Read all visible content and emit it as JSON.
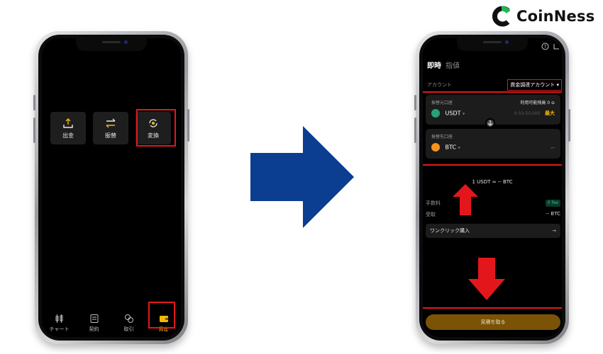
{
  "brand": {
    "name": "CoinNess"
  },
  "left_phone": {
    "actions": [
      {
        "label": "出金",
        "icon": "upload-icon"
      },
      {
        "label": "振替",
        "icon": "transfer-icon"
      },
      {
        "label": "変換",
        "icon": "convert-icon"
      }
    ],
    "bottom_nav": [
      {
        "label": "チャート",
        "icon": "candlestick-icon"
      },
      {
        "label": "契約",
        "icon": "contract-icon"
      },
      {
        "label": "取引",
        "icon": "trade-icon"
      },
      {
        "label": "資産",
        "icon": "wallet-icon",
        "active": true
      }
    ]
  },
  "right_phone": {
    "tabs": [
      "即時",
      "指値"
    ],
    "account_label": "アカウント",
    "account_select": "資金調達アカウント ▾",
    "from_label": "振替元口座",
    "available_label": "利用可能残高 0 ⊖",
    "from_coin": "USDT",
    "from_placeholder": "0.03-50,000",
    "max_label": "最大",
    "to_label": "振替先口座",
    "to_coin": "BTC",
    "to_value": "--",
    "rate": "1 USDT ≈ -- BTC",
    "fee_label": "手数料",
    "fee_badge": "0 fee",
    "receive_label": "受取",
    "receive_value": "-- BTC",
    "one_click": "ワンクリック購入",
    "quote_button": "見積を取る"
  },
  "colors": {
    "highlight_red": "#e3171b",
    "arrow_blue": "#0b3d91",
    "accent_gold": "#f0b90b",
    "usdt_teal": "#26a17b",
    "btc_orange": "#f7931a"
  }
}
